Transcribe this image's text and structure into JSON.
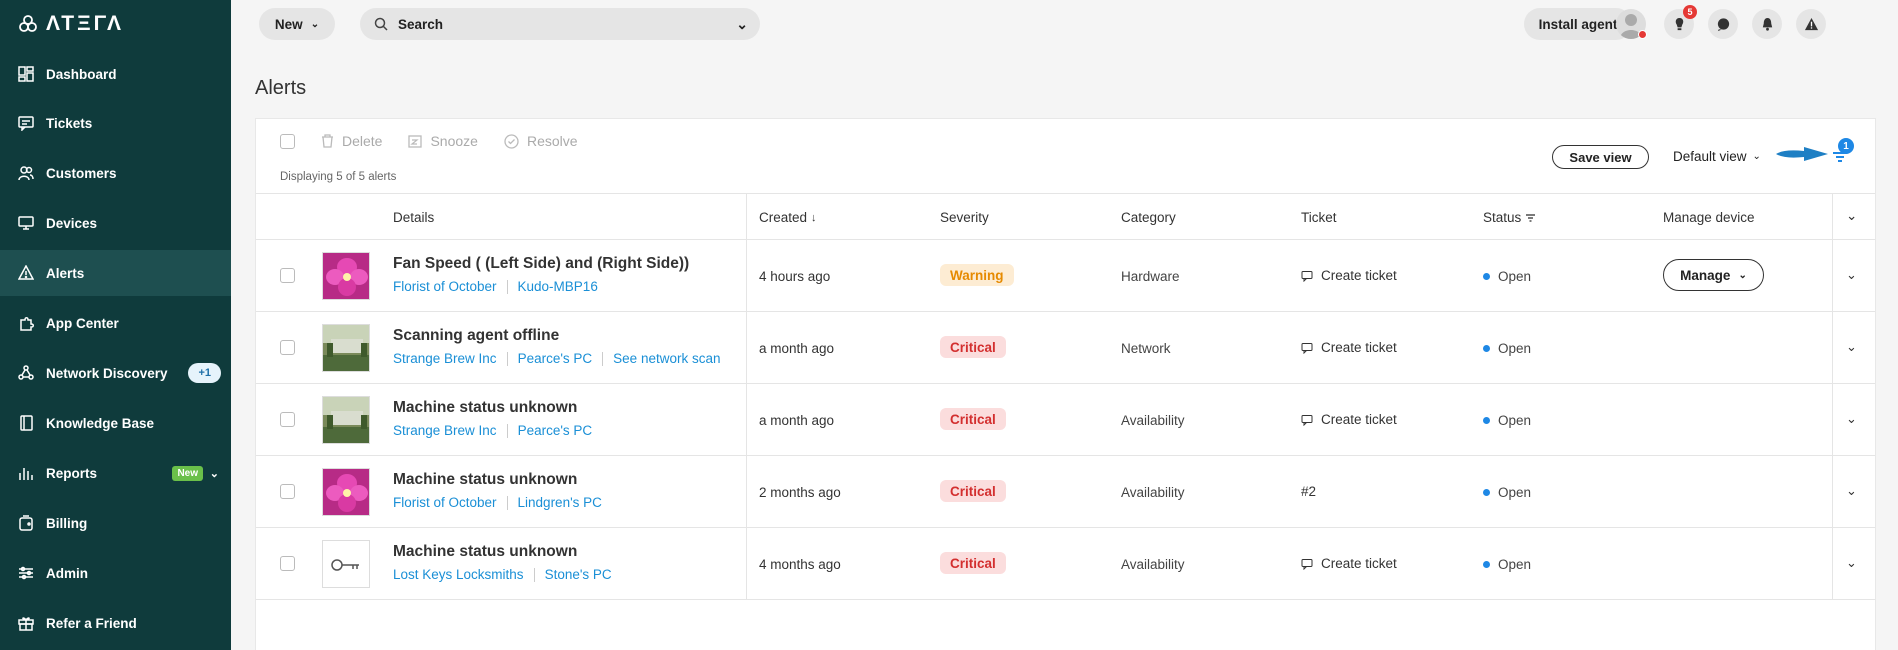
{
  "app": {
    "logo_text": "ΛΤΞΓΛ"
  },
  "sidebar": {
    "items": [
      {
        "label": "Dashboard",
        "icon": "dashboard-icon"
      },
      {
        "label": "Tickets",
        "icon": "tickets-icon"
      },
      {
        "label": "Customers",
        "icon": "customers-icon"
      },
      {
        "label": "Devices",
        "icon": "devices-icon"
      },
      {
        "label": "Alerts",
        "icon": "alerts-icon",
        "active": true
      },
      {
        "label": "App Center",
        "icon": "app-center-icon"
      },
      {
        "label": "Network Discovery",
        "icon": "network-discovery-icon",
        "badge": "+1"
      },
      {
        "label": "Knowledge Base",
        "icon": "knowledge-base-icon"
      },
      {
        "label": "Reports",
        "icon": "reports-icon",
        "badge": "New"
      },
      {
        "label": "Billing",
        "icon": "billing-icon"
      },
      {
        "label": "Admin",
        "icon": "admin-icon"
      },
      {
        "label": "Refer a Friend",
        "icon": "gift-icon"
      }
    ]
  },
  "topbar": {
    "new_label": "New",
    "search_placeholder": "Search",
    "install_label": "Install agent",
    "notification_count": "5"
  },
  "page": {
    "title": "Alerts"
  },
  "toolbar": {
    "delete": "Delete",
    "snooze": "Snooze",
    "resolve": "Resolve",
    "displaying": "Displaying 5 of 5 alerts",
    "save_view": "Save view",
    "default_view": "Default view",
    "filter_count": "1"
  },
  "table": {
    "headers": {
      "details": "Details",
      "created": "Created",
      "severity": "Severity",
      "category": "Category",
      "ticket": "Ticket",
      "status": "Status",
      "manage": "Manage device"
    },
    "rows": [
      {
        "title": "Fan Speed ( (Left Side) and (Right Side))",
        "links": [
          "Florist of October",
          "Kudo-MBP16"
        ],
        "created": "4 hours ago",
        "severity": "Warning",
        "category": "Hardware",
        "ticket": "Create ticket",
        "status": "Open",
        "manage": "Manage"
      },
      {
        "title": "Scanning agent offline",
        "links": [
          "Strange Brew Inc",
          "Pearce's PC",
          "See network scan"
        ],
        "created": "a month ago",
        "severity": "Critical",
        "category": "Network",
        "ticket": "Create ticket",
        "status": "Open"
      },
      {
        "title": "Machine status unknown",
        "links": [
          "Strange Brew Inc",
          "Pearce's PC"
        ],
        "created": "a month ago",
        "severity": "Critical",
        "category": "Availability",
        "ticket": "Create ticket",
        "status": "Open"
      },
      {
        "title": "Machine status unknown",
        "links": [
          "Florist of October",
          "Lindgren's PC"
        ],
        "created": "2 months ago",
        "severity": "Critical",
        "category": "Availability",
        "ticket": "#2",
        "status": "Open"
      },
      {
        "title": "Machine status unknown",
        "links": [
          "Lost Keys Locksmiths",
          "Stone's PC"
        ],
        "created": "4 months ago",
        "severity": "Critical",
        "category": "Availability",
        "ticket": "Create ticket",
        "status": "Open"
      }
    ]
  },
  "colors": {
    "sidebar_bg": "#0f3b3c",
    "link": "#1a8fd6",
    "critical": "#d32f2f",
    "warning": "#e68a00",
    "open_dot": "#1e88e5"
  }
}
